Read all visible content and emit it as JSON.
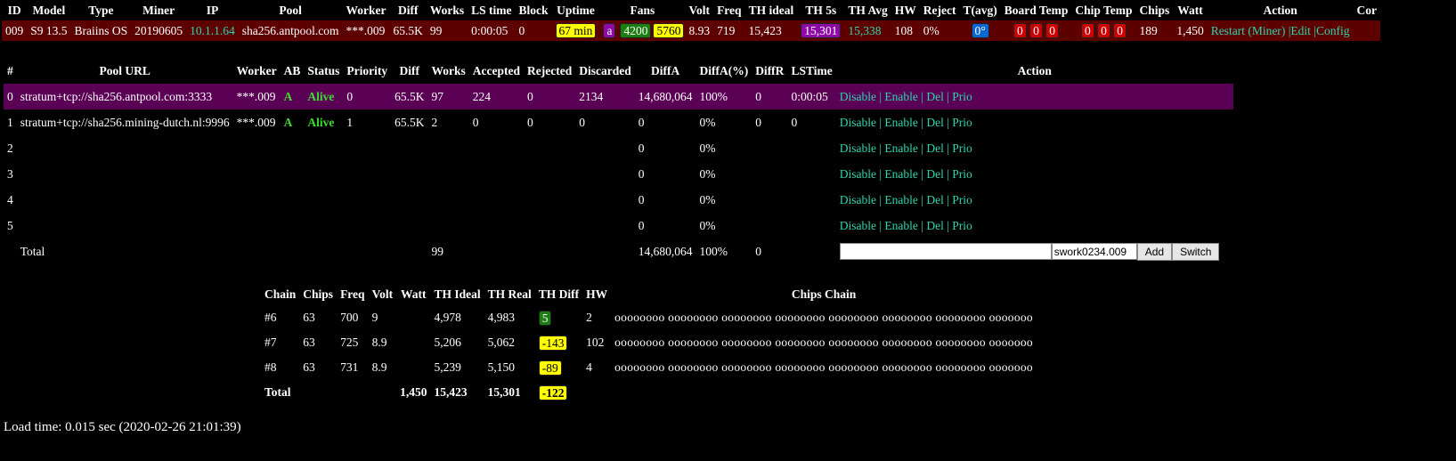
{
  "miner": {
    "headers": [
      "ID",
      "Model",
      "Type",
      "Miner",
      "IP",
      "Pool",
      "Worker",
      "Diff",
      "Works",
      "LS time",
      "Block",
      "Uptime",
      "Fans",
      "Volt",
      "Freq",
      "TH ideal",
      "TH 5s",
      "TH Avg",
      "HW",
      "Reject",
      "T(avg)",
      "Board Temp",
      "Chip Temp",
      "Chips",
      "Watt",
      "Action",
      "Cor"
    ],
    "row": {
      "id": "009",
      "model": "S9 13.5",
      "type": "Braiins OS",
      "miner": "20190605",
      "ip": "10.1.1.64",
      "pool": "sha256.antpool.com",
      "worker": "***.009",
      "diff": "65.5K",
      "works": "99",
      "ls_time": "0:00:05",
      "block": "0",
      "uptime": "67 min",
      "fan_mode": "a",
      "fan1": "4200",
      "fan2": "5760",
      "volt": "8.93",
      "freq": "719",
      "th_ideal": "15,423",
      "th_5s": "15,301",
      "th_avg": "15,338",
      "hw": "108",
      "reject": "0%",
      "t_avg": "0°",
      "board_temps": [
        "0",
        "0",
        "0"
      ],
      "chip_temps": [
        "0",
        "0",
        "0"
      ],
      "chips": "189",
      "watt": "1,450",
      "action_restart": "Restart",
      "action_paren_open": "(",
      "action_miner": "Miner",
      "action_paren_close": ")",
      "action_edit": "Edit",
      "action_config": "Config"
    }
  },
  "pools": {
    "headers": [
      "#",
      "Pool URL",
      "Worker",
      "AB",
      "Status",
      "Priority",
      "Diff",
      "Works",
      "Accepted",
      "Rejected",
      "Discarded",
      "DiffA",
      "DiffA(%)",
      "DiffR",
      "LSTime",
      "Action"
    ],
    "rows": [
      {
        "idx": "0",
        "url": "stratum+tcp://sha256.antpool.com:3333",
        "worker": "***.009",
        "ab": "A",
        "status": "Alive",
        "priority": "0",
        "diff": "65.5K",
        "works": "97",
        "accepted": "224",
        "rejected": "0",
        "discarded": "2134",
        "diffa": "14,680,064",
        "diffa_pct": "100%",
        "diffr": "0",
        "lstime": "0:00:05"
      },
      {
        "idx": "1",
        "url": "stratum+tcp://sha256.mining-dutch.nl:9996",
        "worker": "***.009",
        "ab": "A",
        "status": "Alive",
        "priority": "1",
        "diff": "65.5K",
        "works": "2",
        "accepted": "0",
        "rejected": "0",
        "discarded": "0",
        "diffa": "0",
        "diffa_pct": "0%",
        "diffr": "0",
        "lstime": "0"
      },
      {
        "idx": "2",
        "url": "",
        "worker": "",
        "ab": "",
        "status": "",
        "priority": "",
        "diff": "",
        "works": "",
        "accepted": "",
        "rejected": "",
        "discarded": "",
        "diffa": "0",
        "diffa_pct": "0%",
        "diffr": "",
        "lstime": ""
      },
      {
        "idx": "3",
        "url": "",
        "worker": "",
        "ab": "",
        "status": "",
        "priority": "",
        "diff": "",
        "works": "",
        "accepted": "",
        "rejected": "",
        "discarded": "",
        "diffa": "0",
        "diffa_pct": "0%",
        "diffr": "",
        "lstime": ""
      },
      {
        "idx": "4",
        "url": "",
        "worker": "",
        "ab": "",
        "status": "",
        "priority": "",
        "diff": "",
        "works": "",
        "accepted": "",
        "rejected": "",
        "discarded": "",
        "diffa": "0",
        "diffa_pct": "0%",
        "diffr": "",
        "lstime": ""
      },
      {
        "idx": "5",
        "url": "",
        "worker": "",
        "ab": "",
        "status": "",
        "priority": "",
        "diff": "",
        "works": "",
        "accepted": "",
        "rejected": "",
        "discarded": "",
        "diffa": "0",
        "diffa_pct": "0%",
        "diffr": "",
        "lstime": ""
      }
    ],
    "actions": {
      "disable": "Disable",
      "enable": "Enable",
      "del": "Del",
      "prio": "Prio",
      "sep": "|"
    },
    "total": {
      "label": "Total",
      "works": "99",
      "diffa": "14,680,064",
      "diffa_pct": "100%",
      "diffr": "0"
    },
    "add_form": {
      "pool_value": "",
      "worker_value": "swork0234.009",
      "add_label": "Add",
      "switch_label": "Switch"
    }
  },
  "chains": {
    "headers": [
      "Chain",
      "Chips",
      "Freq",
      "Volt",
      "Watt",
      "TH Ideal",
      "TH Real",
      "TH Diff",
      "HW",
      "Chips Chain"
    ],
    "rows": [
      {
        "chain": "#6",
        "chips": "63",
        "freq": "700",
        "volt": "9",
        "watt": "",
        "th_ideal": "4,978",
        "th_real": "4,983",
        "th_diff": "5",
        "th_diff_color": "#1b7d12",
        "hw": "2",
        "chips_chain": "oooooooo oooooooo oooooooo oooooooo oooooooo oooooooo oooooooo ooooooo"
      },
      {
        "chain": "#7",
        "chips": "63",
        "freq": "725",
        "volt": "8.9",
        "watt": "",
        "th_ideal": "5,206",
        "th_real": "5,062",
        "th_diff": "-143",
        "th_diff_color": "#ffff00",
        "hw": "102",
        "chips_chain": "oooooooo oooooooo oooooooo oooooooo oooooooo oooooooo oooooooo ooooooo"
      },
      {
        "chain": "#8",
        "chips": "63",
        "freq": "731",
        "volt": "8.9",
        "watt": "",
        "th_ideal": "5,239",
        "th_real": "5,150",
        "th_diff": "-89",
        "th_diff_color": "#ffff00",
        "hw": "4",
        "chips_chain": "oooooooo oooooooo oooooooo oooooooo oooooooo oooooooo oooooooo ooooooo"
      }
    ],
    "total": {
      "label": "Total",
      "watt": "1,450",
      "th_ideal": "15,423",
      "th_real": "15,301",
      "th_diff": "-122",
      "th_diff_color": "#ffff00"
    }
  },
  "load_time": "Load time: 0.015 sec (2020-02-26 21:01:39)"
}
